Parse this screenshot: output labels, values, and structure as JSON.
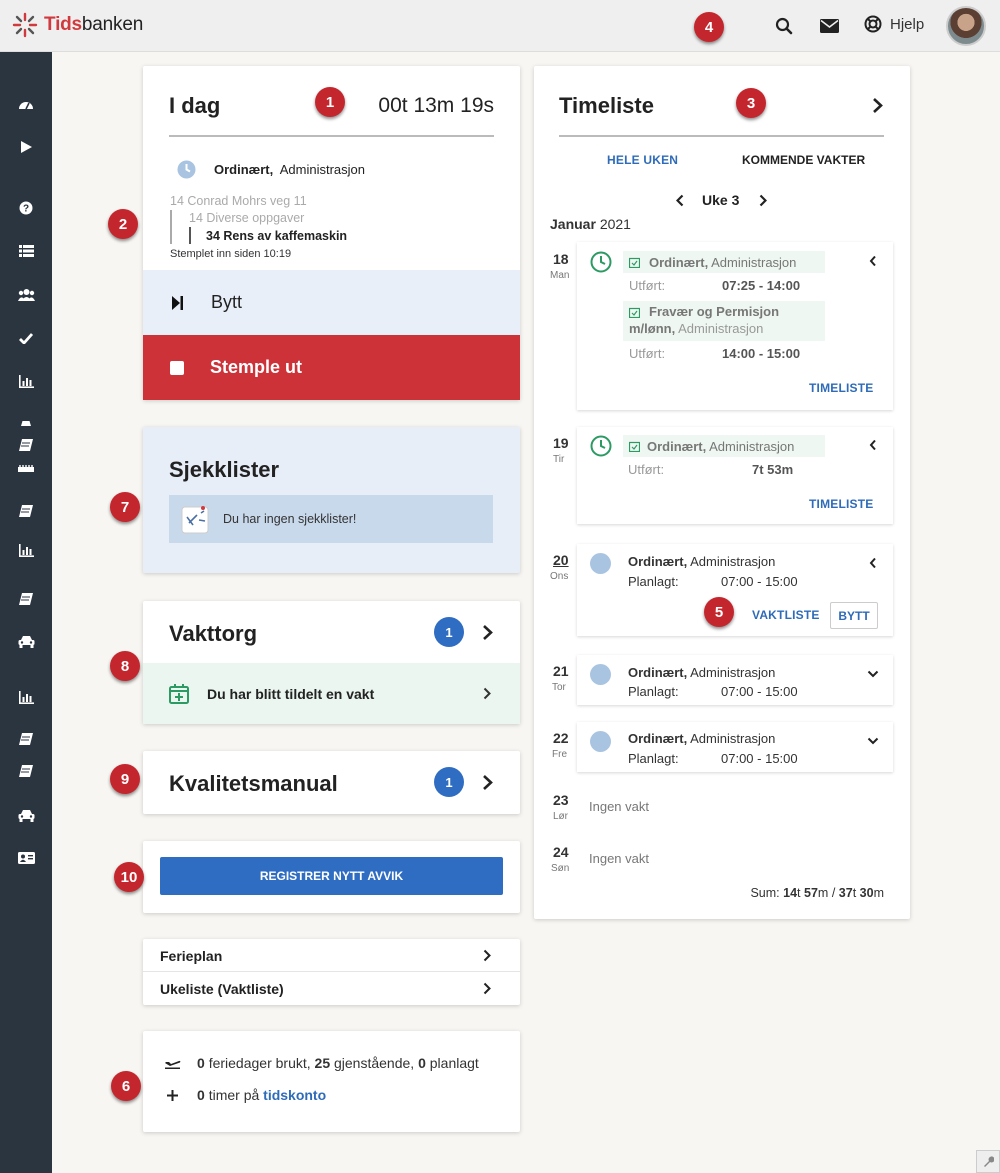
{
  "topbar": {
    "brand_prefix": "Tids",
    "brand_suffix": "banken",
    "help_label": "Hjelp",
    "icons": [
      "search-icon",
      "mail-icon",
      "lifebuoy-icon"
    ]
  },
  "markers": [
    "1",
    "2",
    "3",
    "4",
    "5",
    "6",
    "7",
    "8",
    "9",
    "10"
  ],
  "today": {
    "title": "I dag",
    "timer": "00t 13m 19s",
    "shift_type": "Ordinært,",
    "shift_dept": "Administrasjon",
    "path_1": "14 Conrad Mohrs veg 11",
    "path_2": "14 Diverse oppgaver",
    "path_3": "34 Rens av kaffemaskin",
    "stamped": "Stemplet inn siden 10:19",
    "switch_label": "Bytt",
    "stamp_out_label": "Stemple ut"
  },
  "checklists": {
    "title": "Sjekklister",
    "empty_text": "Du har ingen sjekklister!"
  },
  "vakttorg": {
    "title": "Vakttorg",
    "badge": "1",
    "notice": "Du har blitt tildelt en vakt"
  },
  "quality": {
    "title": "Kvalitetsmanual",
    "badge": "1"
  },
  "deviation": {
    "button_label": "REGISTRER NYTT AVVIK"
  },
  "links": [
    {
      "label": "Ferieplan"
    },
    {
      "label": "Ukeliste (Vaktliste)"
    }
  ],
  "vacation": {
    "used_num": "0",
    "used_text": "feriedager brukt,",
    "remaining_num": "25",
    "remaining_text": "gjenstående,",
    "planned_num": "0",
    "planned_text": "planlagt",
    "hours_num": "0",
    "hours_text": "timer på",
    "account_link": "tidskonto"
  },
  "timesheet": {
    "title": "Timeliste",
    "tab_week": "HELE UKEN",
    "tab_upcoming": "KOMMENDE VAKTER",
    "week_label": "Uke 3",
    "month": "Januar",
    "year": "2021",
    "days": [
      {
        "num": "18",
        "name": "Man"
      },
      {
        "num": "19",
        "name": "Tir"
      },
      {
        "num": "20",
        "name": "Ons"
      },
      {
        "num": "21",
        "name": "Tor"
      },
      {
        "num": "22",
        "name": "Fre"
      },
      {
        "num": "23",
        "name": "Lør"
      },
      {
        "num": "24",
        "name": "Søn"
      }
    ],
    "mon_e1_type": "Ordinært,",
    "mon_e1_dept": "Administrasjon",
    "mon_e1_lbl": "Utført:",
    "mon_e1_time": "07:25 - 14:00",
    "mon_e2_type_a": "Fravær og Permisjon",
    "mon_e2_type_b": "m/lønn,",
    "mon_e2_dept": "Administrasjon",
    "mon_e2_lbl": "Utført:",
    "mon_e2_time": "14:00 - 15:00",
    "tue_type": "Ordinært,",
    "tue_dept": "Administrasjon",
    "tue_lbl": "Utført:",
    "tue_time": "7t 53m",
    "timeliste_btn": "TIMELISTE",
    "planned_type": "Ordinært,",
    "planned_dept": "Administrasjon",
    "planned_lbl": "Planlagt:",
    "planned_time": "07:00 - 15:00",
    "vaktliste_btn": "VAKTLISTE",
    "bytt_btn": "BYTT",
    "no_shift": "Ingen vakt",
    "sum_label": "Sum:",
    "sum_h1": "14",
    "sum_m1": "57",
    "sum_h2": "37",
    "sum_m2": "30",
    "unit_t": "t",
    "unit_m": "m",
    "slash": "/"
  },
  "colors": {
    "brand_red": "#d03a3f",
    "stamp_out_red": "#cc3238",
    "accent_blue": "#2e6bb8",
    "sidebar": "#2b3540",
    "switch_bg": "#e9eff8",
    "checklist_bg": "#e8eef8",
    "notice_green": "#eaf6ef",
    "clock_green": "#2c9a63"
  }
}
